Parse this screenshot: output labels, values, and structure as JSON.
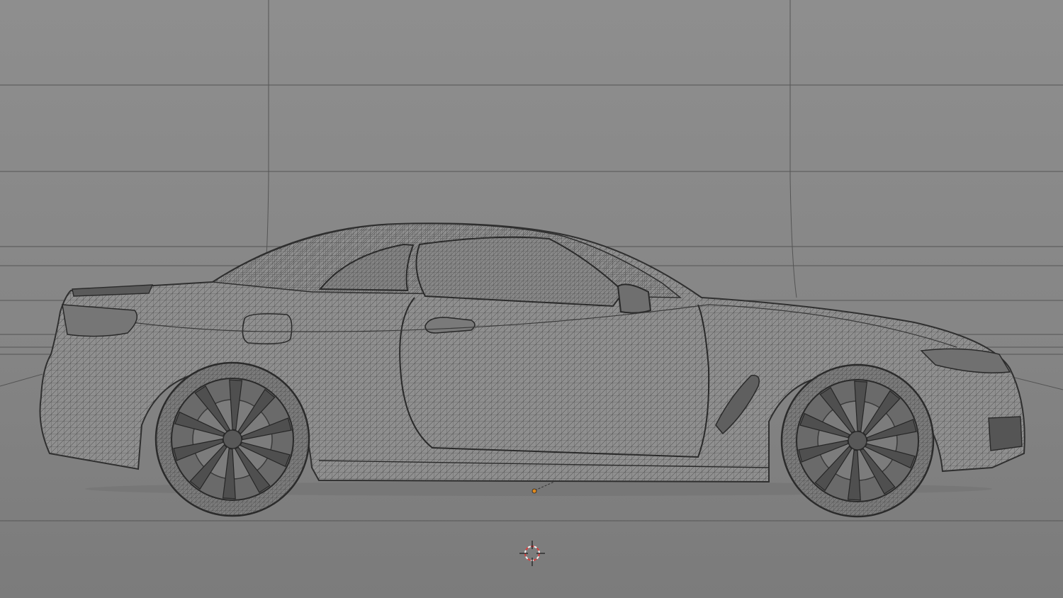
{
  "viewport": {
    "view": "side",
    "shading": "wireframe",
    "colors": {
      "backdrop_top": "#8d8d8d",
      "backdrop_bottom": "#868686",
      "floor_near": "#7a7a7a",
      "floor_far": "#838383",
      "grid_line": "#555555",
      "wire": "#2f2f2f",
      "body_fill": "#8f8f8f",
      "tire_fill": "#7b7b7b",
      "rim_fill": "#6a6a6a",
      "origin_dot": "#e08a1e",
      "cursor_ring": "#d84040"
    }
  },
  "scene": {
    "object": "car-mesh",
    "wheels": 2,
    "spokes_per_wheel": 10
  },
  "icons": {
    "cursor": "3d-cursor-icon",
    "origin": "object-origin-icon"
  }
}
